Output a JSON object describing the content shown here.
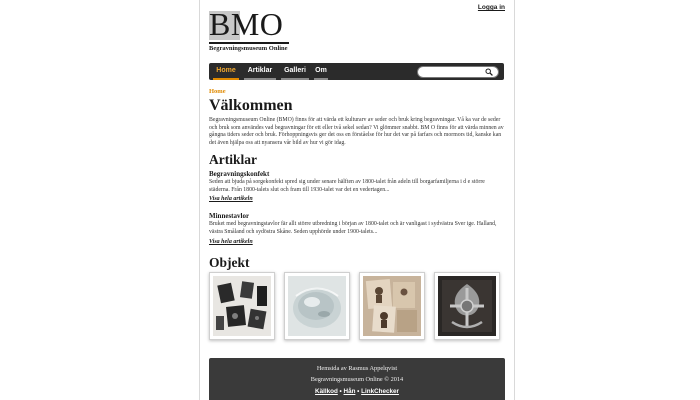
{
  "header": {
    "login_label": "Logga in",
    "logo_text": "BMO",
    "tagline": "Begravningsmuseum Online"
  },
  "nav": {
    "items": [
      {
        "label": "Home",
        "active": true
      },
      {
        "label": "Artiklar",
        "active": false
      },
      {
        "label": "Galleri",
        "active": false
      },
      {
        "label": "Om",
        "active": false
      }
    ],
    "search_placeholder": "",
    "search_icon": "magnifier-icon"
  },
  "breadcrumb": "Home",
  "welcome": {
    "title": "Välkommen",
    "text": "Begravningsmuseum Online (BMO) finns för att värda ett kulturarv av seder och bruk kring begravningar. Vå ka var de seder och bruk som användes vad begravningar för ett eller två sekel sedan? Vi glömmer snabbt. BM O finns för att värda minnen av gångna tiders seder och bruk. Förhoppningsvis ger det oss en förståelse för hur det var på farfars och mormors tid, kanske kan det även hjälpa oss att nyansera vår bild av hur vi gör idag."
  },
  "articles": {
    "title": "Artiklar",
    "items": [
      {
        "title": "Begravningskonfekt",
        "text": "Seden att bjuda på sorgekonfekt spred sig under senare hälften av 1800-talet från adeln till borgarfamiljerna i d e större städerna. Från 1800-talets slut och fram till 1930-talet var det en vedertagen...",
        "link": "Visa hela artikeln"
      },
      {
        "title": "Minnestavlor",
        "text": "Bruket med begravningstavlor fär allt större utbredning i början av 1800-talet och är vanligast i sydvästra Sver ige. Halland, västra Småland och sydöstra Skåne. Seden upphörde under 1900-talets...",
        "link": "Visa hela artikeln"
      }
    ]
  },
  "objects": {
    "title": "Objekt",
    "thumbnails": [
      "photo-dark-cards",
      "photo-glass-dish",
      "photo-old-portraits",
      "photo-silver-ornament"
    ]
  },
  "footer": {
    "line1": "Hemsida av Rasmus Appelqvist",
    "line2": "Begravningsmuseum Online © 2014",
    "links": [
      "Källkod",
      "Hån",
      "LinkChecker"
    ],
    "separator": "•"
  },
  "colors": {
    "accent": "#e08a00",
    "navbar": "#2b2b2b",
    "footer": "#3a3a3a"
  }
}
